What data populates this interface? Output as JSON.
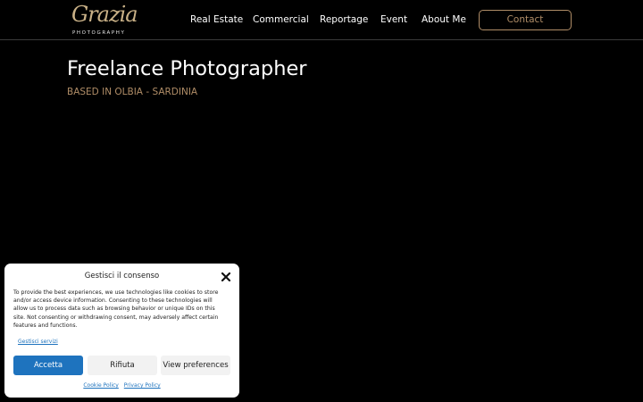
{
  "header": {
    "logo_script": "Grazia",
    "logo_sub": "PHOTOGRAPHY",
    "nav": [
      {
        "label": "Real Estate"
      },
      {
        "label": "Commercial"
      },
      {
        "label": "Reportage"
      },
      {
        "label": "Event"
      },
      {
        "label": "About Me"
      }
    ],
    "contact_label": "Contact"
  },
  "hero": {
    "title": "Freelance Photographer",
    "subtitle": "BASED IN OLBIA - SARDINIA"
  },
  "consent": {
    "title": "Gestisci il consenso",
    "text": "To provide the best experiences, we use technologies like cookies to store and/or access device information. Consenting to these technologies will allow us to process data such as browsing behavior or unique IDs on this site. Not consenting or withdrawing consent, may adversely affect certain features and functions.",
    "manage_link": "Gestisci servizi",
    "accept_label": "Accetta",
    "deny_label": "Rifiuta",
    "prefs_label": "View preferences",
    "cookie_policy": "Cookie Policy",
    "privacy_policy": "Privacy Policy"
  },
  "colors": {
    "background": "#000000",
    "accent": "#b08d67",
    "accept_button": "#1e73be"
  }
}
